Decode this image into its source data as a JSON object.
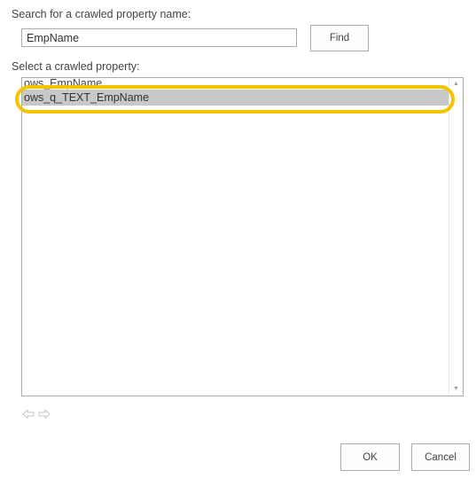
{
  "search": {
    "label": "Search for a crawled property name:",
    "value": "EmpName",
    "find_label": "Find"
  },
  "select": {
    "label": "Select a crawled property:",
    "items": [
      {
        "label": "ows_EmpName",
        "selected": false
      },
      {
        "label": "ows_q_TEXT_EmpName",
        "selected": true
      }
    ]
  },
  "highlight": {
    "color": "#f5c400"
  },
  "footer": {
    "ok_label": "OK",
    "cancel_label": "Cancel"
  }
}
